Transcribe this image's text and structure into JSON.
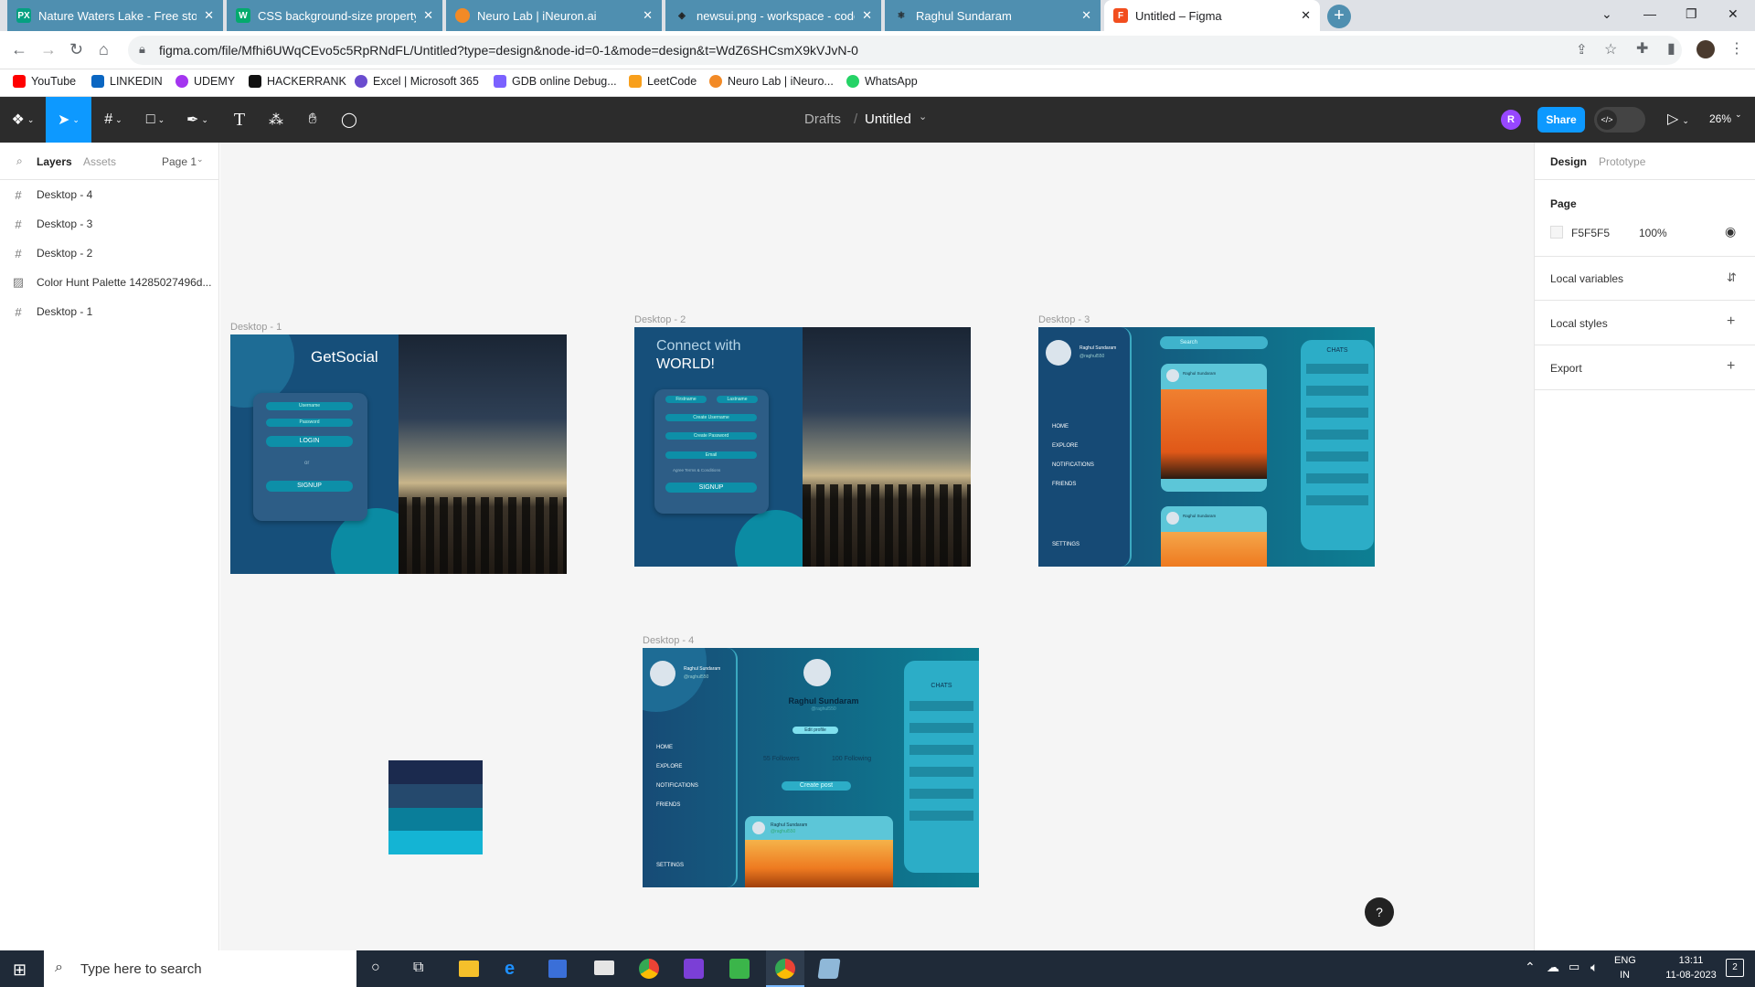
{
  "browser": {
    "tabs": [
      {
        "title": "Nature Waters Lake - Free stock",
        "fav": "PX",
        "favColor": "#05a081"
      },
      {
        "title": "CSS background-size property",
        "fav": "W",
        "favColor": "#04aa6d"
      },
      {
        "title": "Neuro Lab | iNeuron.ai",
        "fav": "",
        "favColor": "#f28a26"
      },
      {
        "title": "newsui.png - workspace - code-s",
        "fav": "",
        "favColor": "#2a2a2a"
      },
      {
        "title": "Raghul Sundaram",
        "fav": "",
        "favColor": "#2a2a2a"
      },
      {
        "title": "Untitled – Figma",
        "fav": "F",
        "favColor": "#f24e1e"
      }
    ],
    "url": "figma.com/file/Mfhi6UWqCEvo5c5RpRNdFL/Untitled?type=design&node-id=0-1&mode=design&t=WdZ6SHCsmX9kVJvN-0",
    "bookmarks": [
      {
        "label": "YouTube",
        "color": "#ff0000"
      },
      {
        "label": "LINKEDIN",
        "color": "#0a66c2"
      },
      {
        "label": "UDEMY",
        "color": "#a435f0"
      },
      {
        "label": "HACKERRANK",
        "color": "#1ba94c"
      },
      {
        "label": "Excel | Microsoft 365",
        "color": "#6a4ccf"
      },
      {
        "label": "GDB online Debug...",
        "color": "#7b61ff"
      },
      {
        "label": "LeetCode",
        "color": "#f89f1b"
      },
      {
        "label": "Neuro Lab | iNeuro...",
        "color": "#f28a26"
      },
      {
        "label": "WhatsApp",
        "color": "#25d366"
      }
    ]
  },
  "figma": {
    "breadcrumb_drafts": "Drafts",
    "breadcrumb_sep": "/",
    "file_name": "Untitled",
    "avatar_letter": "R",
    "share": "Share",
    "zoom": "26%",
    "left_tabs": {
      "layers": "Layers",
      "assets": "Assets",
      "page": "Page 1"
    },
    "layers": [
      {
        "name": "Desktop - 4",
        "icon": "#"
      },
      {
        "name": "Desktop - 3",
        "icon": "#"
      },
      {
        "name": "Desktop - 2",
        "icon": "#"
      },
      {
        "name": "Color Hunt Palette 14285027496d...",
        "icon": "▨"
      },
      {
        "name": "Desktop - 1",
        "icon": "#"
      }
    ],
    "right": {
      "tab_design": "Design",
      "tab_prototype": "Prototype",
      "page_heading": "Page",
      "page_color": "F5F5F5",
      "page_opacity": "100%",
      "local_variables": "Local variables",
      "local_styles": "Local styles",
      "export": "Export"
    },
    "help": "?"
  },
  "frames": {
    "d1": {
      "label": "Desktop - 1",
      "brand": "GetSocial",
      "username": "Username",
      "password": "Password",
      "login": "LOGIN",
      "or": "or",
      "signup": "SIGNUP"
    },
    "d2": {
      "label": "Desktop - 2",
      "line1": "Connect with",
      "line2": "WORLD!",
      "firstname": "Firstname",
      "lastname": "Lastname",
      "username": "Create Username",
      "password": "Create Password",
      "email": "Email",
      "agree": "Agree Terms & Conditions",
      "signup": "SIGNUP"
    },
    "d3": {
      "label": "Desktop - 3",
      "name": "Raghul Sundaram",
      "handle": "@raghul550",
      "search": "Search",
      "nav": [
        "HOME",
        "EXPLORE",
        "NOTIFICATIONS",
        "FRIENDS"
      ],
      "settings": "SETTINGS",
      "chats": "CHATS"
    },
    "d4": {
      "label": "Desktop - 4",
      "name": "Raghul Sundaram",
      "handle": "@raghul550",
      "edit": "Edit profile",
      "followers": "55 Followers",
      "following": "100 Following",
      "create": "Create post",
      "nav": [
        "HOME",
        "EXPLORE",
        "NOTIFICATIONS",
        "FRIENDS"
      ],
      "settings": "SETTINGS",
      "chats": "CHATS"
    },
    "palette": [
      "#1b2a4e",
      "#25496d",
      "#0a7e9a",
      "#14b4d4"
    ]
  },
  "taskbar": {
    "search": "Type here to search",
    "lang1": "ENG",
    "lang2": "IN",
    "time": "13:11",
    "date": "11-08-2023",
    "notif": "2"
  },
  "colors": {
    "figma_blue": "#0d99ff",
    "figma_dark": "#2c2c2c",
    "teal": "#0d7f93",
    "navy": "#1b4b75"
  }
}
